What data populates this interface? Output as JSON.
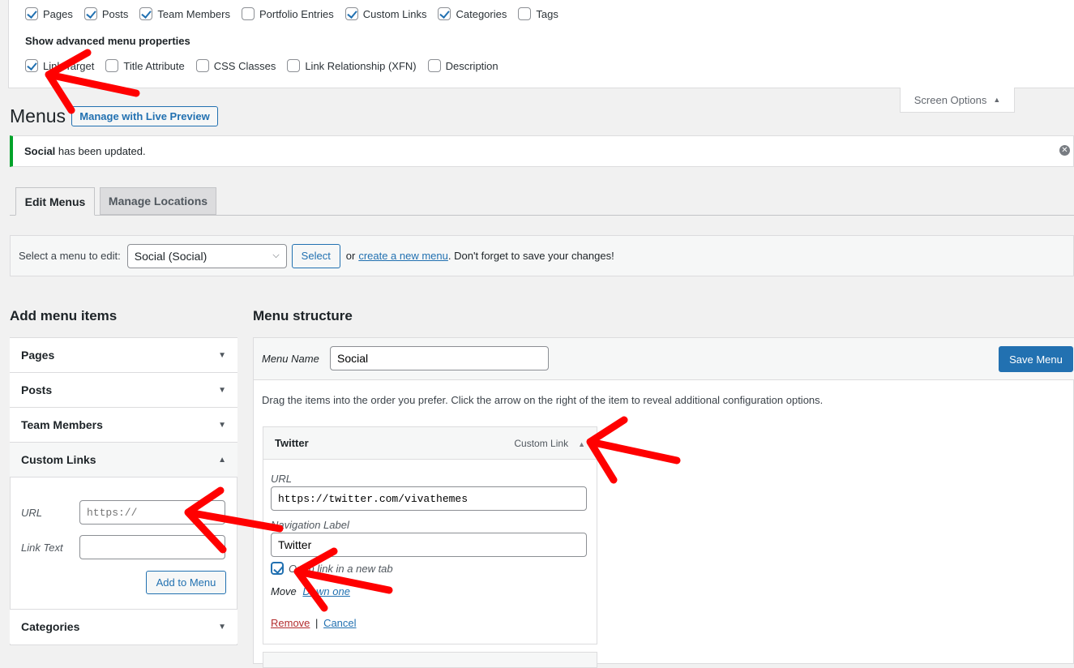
{
  "screen_options": {
    "boxes": [
      {
        "label": "Pages",
        "checked": true
      },
      {
        "label": "Posts",
        "checked": true
      },
      {
        "label": "Team Members",
        "checked": true
      },
      {
        "label": "Portfolio Entries",
        "checked": false
      },
      {
        "label": "Custom Links",
        "checked": true
      },
      {
        "label": "Categories",
        "checked": true
      },
      {
        "label": "Tags",
        "checked": false
      }
    ],
    "advanced_heading": "Show advanced menu properties",
    "advanced": [
      {
        "label": "Link Target",
        "checked": true
      },
      {
        "label": "Title Attribute",
        "checked": false
      },
      {
        "label": "CSS Classes",
        "checked": false
      },
      {
        "label": "Link Relationship (XFN)",
        "checked": false
      },
      {
        "label": "Description",
        "checked": false
      }
    ],
    "toggle_label": "Screen Options",
    "toggle_icon": "▲"
  },
  "header": {
    "title": "Menus",
    "live_preview": "Manage with Live Preview"
  },
  "notice": {
    "bold": "Social",
    "text": " has been updated."
  },
  "tabs": [
    {
      "label": "Edit Menus",
      "active": true
    },
    {
      "label": "Manage Locations",
      "active": false
    }
  ],
  "select_bar": {
    "label": "Select a menu to edit:",
    "value": "Social (Social)",
    "button": "Select",
    "or": "or",
    "create_link": "create a new menu",
    "tail": ". Don't forget to save your changes!"
  },
  "add_items": {
    "title": "Add menu items",
    "sections": [
      "Pages",
      "Posts",
      "Team Members",
      "Custom Links",
      "Categories"
    ],
    "custom": {
      "url_label": "URL",
      "url_placeholder": "https://",
      "text_label": "Link Text",
      "button": "Add to Menu"
    }
  },
  "structure": {
    "title": "Menu structure",
    "name_label": "Menu Name",
    "name_value": "Social",
    "save": "Save Menu",
    "instructions": "Drag the items into the order you prefer. Click the arrow on the right of the item to reveal additional configuration options.",
    "item": {
      "title": "Twitter",
      "type": "Custom Link",
      "url_label": "URL",
      "url": "https://twitter.com/vivathemes",
      "nav_label": "Navigation Label",
      "nav_value": "Twitter",
      "new_tab": "Open link in a new tab",
      "new_tab_checked": true,
      "move": "Move",
      "down_one": "Down one",
      "remove": "Remove",
      "sep": "|",
      "cancel": "Cancel"
    }
  },
  "colors": {
    "accent": "#2271b1",
    "success": "#00a32a",
    "annotation": "#ff0000",
    "remove": "#b32d2e"
  }
}
